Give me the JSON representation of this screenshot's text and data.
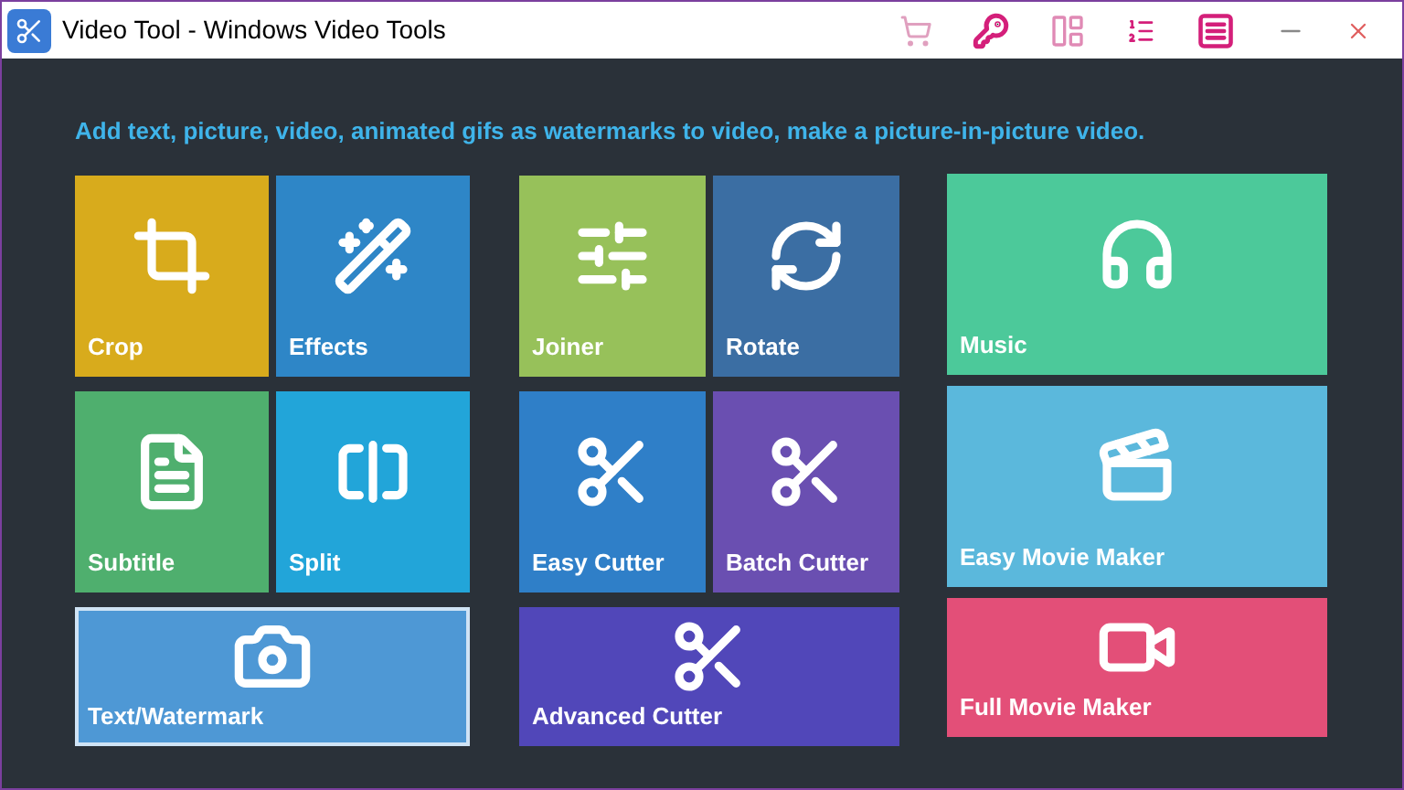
{
  "window": {
    "title": "Video Tool - Windows Video Tools"
  },
  "headline": "Add text, picture, video, animated gifs as watermarks to video, make a picture-in-picture video.",
  "groups": [
    {
      "tiles": [
        {
          "label": "Crop",
          "color": "#d8ab1c",
          "selected": false
        },
        {
          "label": "Effects",
          "color": "#2e86c7",
          "selected": false
        },
        {
          "label": "Subtitle",
          "color": "#4faf6e",
          "selected": false
        },
        {
          "label": "Split",
          "color": "#22a5d9",
          "selected": false
        },
        {
          "label": "Text/Watermark",
          "color": "#4e98d5",
          "selected": true
        }
      ]
    },
    {
      "tiles": [
        {
          "label": "Joiner",
          "color": "#97c15a",
          "selected": false
        },
        {
          "label": "Rotate",
          "color": "#3b6ea3",
          "selected": false
        },
        {
          "label": "Easy Cutter",
          "color": "#2f7fc8",
          "selected": false
        },
        {
          "label": "Batch Cutter",
          "color": "#6a4fb1",
          "selected": false
        },
        {
          "label": "Advanced Cutter",
          "color": "#5147b9",
          "selected": false
        }
      ]
    },
    {
      "tiles": [
        {
          "label": "Music",
          "color": "#4cc99a",
          "selected": false
        },
        {
          "label": "Easy Movie Maker",
          "color": "#5bb8dc",
          "selected": false
        },
        {
          "label": "Full Movie Maker",
          "color": "#e34f78",
          "selected": false
        }
      ]
    }
  ]
}
